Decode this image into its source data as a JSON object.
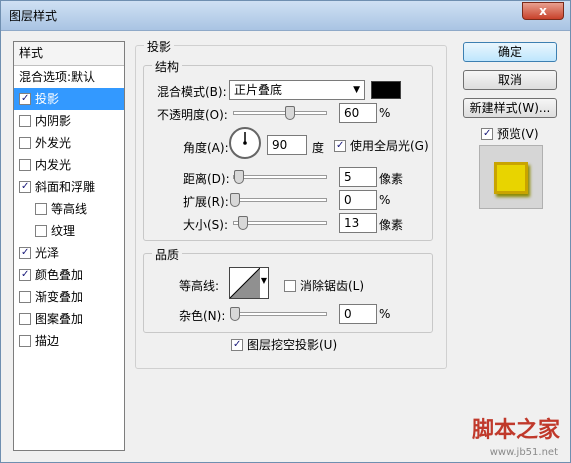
{
  "window": {
    "title": "图层样式",
    "close_label": "x"
  },
  "left_panel": {
    "header": "样式",
    "blend_options": "混合选项:默认",
    "items": [
      {
        "label": "投影",
        "checked": true,
        "selected": true,
        "sub": false
      },
      {
        "label": "内阴影",
        "checked": false,
        "selected": false,
        "sub": false
      },
      {
        "label": "外发光",
        "checked": false,
        "selected": false,
        "sub": false
      },
      {
        "label": "内发光",
        "checked": false,
        "selected": false,
        "sub": false
      },
      {
        "label": "斜面和浮雕",
        "checked": true,
        "selected": false,
        "sub": false
      },
      {
        "label": "等高线",
        "checked": false,
        "selected": false,
        "sub": true
      },
      {
        "label": "纹理",
        "checked": false,
        "selected": false,
        "sub": true
      },
      {
        "label": "光泽",
        "checked": true,
        "selected": false,
        "sub": false
      },
      {
        "label": "颜色叠加",
        "checked": true,
        "selected": false,
        "sub": false
      },
      {
        "label": "渐变叠加",
        "checked": false,
        "selected": false,
        "sub": false
      },
      {
        "label": "图案叠加",
        "checked": false,
        "selected": false,
        "sub": false
      },
      {
        "label": "描边",
        "checked": false,
        "selected": false,
        "sub": false
      }
    ]
  },
  "drop_shadow": {
    "section_title": "投影",
    "structure": {
      "title": "结构",
      "blend_mode_label": "混合模式(B):",
      "blend_mode_value": "正片叠底",
      "shadow_color": "#000000",
      "opacity_label": "不透明度(O):",
      "opacity_value": "60",
      "opacity_unit": "%",
      "opacity_level": 0.6,
      "angle_label": "角度(A):",
      "angle_value": "90",
      "angle_unit": "度",
      "global_light_label": "使用全局光(G)",
      "global_light_checked": true,
      "distance_label": "距离(D):",
      "distance_value": "5",
      "distance_unit": "像素",
      "spread_label": "扩展(R):",
      "spread_value": "0",
      "spread_unit": "%",
      "size_label": "大小(S):",
      "size_value": "13",
      "size_unit": "像素"
    },
    "quality": {
      "title": "品质",
      "contour_label": "等高线:",
      "anti_alias_label": "消除锯齿(L)",
      "anti_alias_checked": false,
      "noise_label": "杂色(N):",
      "noise_value": "0",
      "noise_unit": "%"
    },
    "knockout_label": "图层挖空投影(U)",
    "knockout_checked": true
  },
  "buttons": {
    "ok": "确定",
    "cancel": "取消",
    "new_style": "新建样式(W)...",
    "preview_label": "预览(V)",
    "preview_checked": true
  },
  "watermark": {
    "text": "脚本之家",
    "url": "www.jb51.net"
  }
}
